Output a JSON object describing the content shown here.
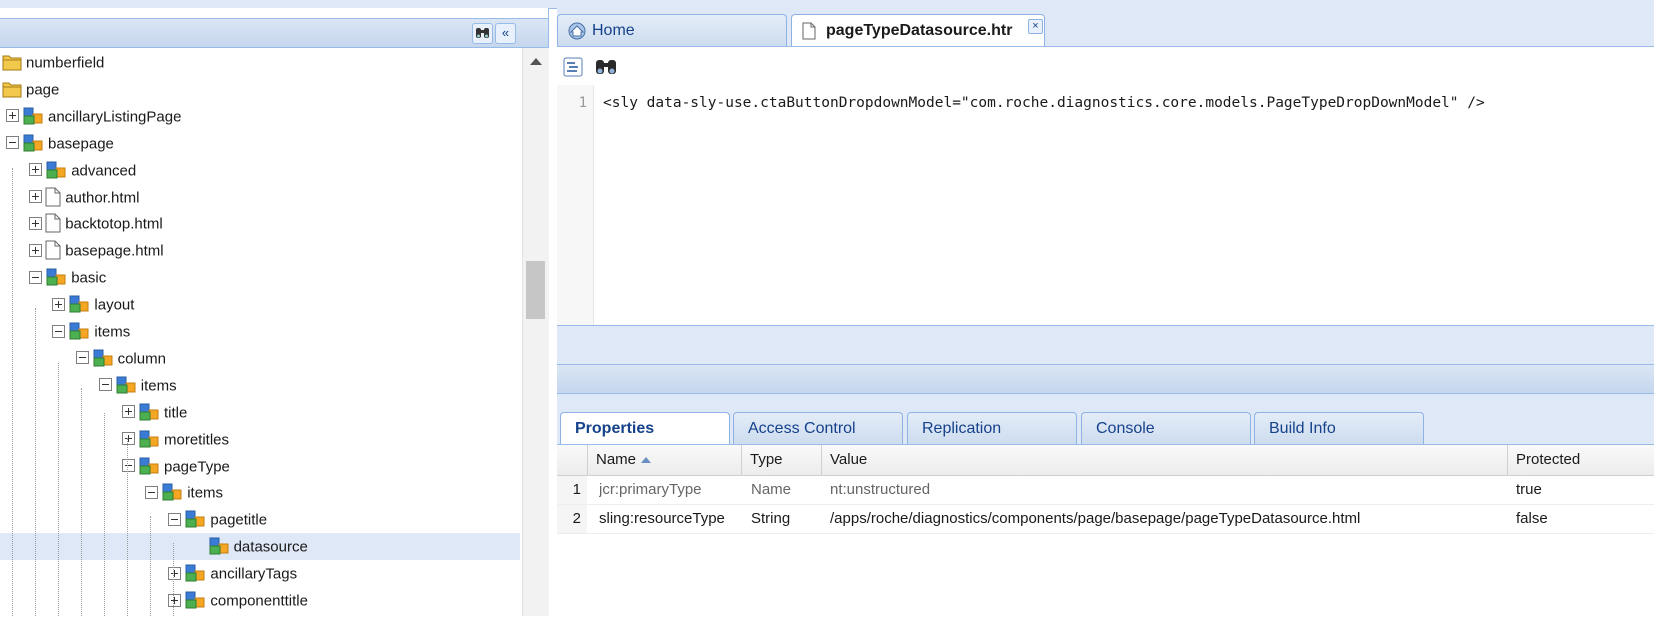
{
  "tree": {
    "header_buttons": [
      {
        "name": "find-button",
        "icon": "binoculars-icon"
      },
      {
        "name": "collapse-panel-button",
        "icon": "double-chevron-left-icon"
      }
    ],
    "nodes": [
      {
        "label": "numberfield",
        "type": "folder"
      },
      {
        "label": "page",
        "type": "folder"
      },
      {
        "label": "ancillaryListingPage",
        "type": "node",
        "toggle": "plus"
      },
      {
        "label": "basepage",
        "type": "node",
        "toggle": "minus"
      },
      {
        "label": "advanced",
        "type": "node",
        "toggle": "plus"
      },
      {
        "label": "author.html",
        "type": "file",
        "toggle": "plus"
      },
      {
        "label": "backtotop.html",
        "type": "file",
        "toggle": "plus"
      },
      {
        "label": "basepage.html",
        "type": "file",
        "toggle": "plus"
      },
      {
        "label": "basic",
        "type": "node",
        "toggle": "minus"
      },
      {
        "label": "layout",
        "type": "node",
        "toggle": "plus"
      },
      {
        "label": "items",
        "type": "node",
        "toggle": "minus"
      },
      {
        "label": "column",
        "type": "node",
        "toggle": "minus"
      },
      {
        "label": "items",
        "type": "node",
        "toggle": "minus"
      },
      {
        "label": "title",
        "type": "node",
        "toggle": "plus"
      },
      {
        "label": "moretitles",
        "type": "node",
        "toggle": "plus"
      },
      {
        "label": "pageType",
        "type": "node",
        "toggle": "minus"
      },
      {
        "label": "items",
        "type": "node",
        "toggle": "minus"
      },
      {
        "label": "pagetitle",
        "type": "node",
        "toggle": "minus"
      },
      {
        "label": "datasource",
        "type": "node",
        "toggle": "none",
        "selected": true
      },
      {
        "label": "ancillaryTags",
        "type": "node",
        "toggle": "plus"
      },
      {
        "label": "componenttitle",
        "type": "node",
        "toggle": "plus"
      }
    ]
  },
  "tabs": [
    {
      "label": "Home",
      "icon": "home-icon",
      "active": false
    },
    {
      "label": "pageTypeDatasource.htr",
      "icon": "file-icon",
      "active": true,
      "close": "×"
    }
  ],
  "editor": {
    "toolbar": [
      {
        "name": "format-button",
        "icon": "format-code-icon"
      },
      {
        "name": "search-button",
        "icon": "binoculars-icon"
      }
    ],
    "lines": [
      {
        "number": "1",
        "text": "<sly data-sly-use.ctaButtonDropdownModel=\"com.roche.diagnostics.core.models.PageTypeDropDownModel\" />"
      }
    ]
  },
  "properties": {
    "tabs": [
      "Properties",
      "Access Control",
      "Replication",
      "Console",
      "Build Info"
    ],
    "active_tab": "Properties",
    "columns": [
      "Name",
      "Type",
      "Value",
      "Protected"
    ],
    "sort_column": "Name",
    "sort_direction": "ascending",
    "rows": [
      {
        "num": "1",
        "name": "jcr:primaryType",
        "type": "Name",
        "value": "nt:unstructured",
        "protected": "true"
      },
      {
        "num": "2",
        "name": "sling:resourceType",
        "type": "String",
        "value": "/apps/roche/diagnostics/components/page/basepage/pageTypeDatasource.html",
        "protected": "false"
      }
    ]
  },
  "colors": {
    "panel_bg": "#dfe8f6",
    "border": "#99bbe8",
    "header_text": "#15428b",
    "selected_row": "#dfe8f6",
    "folder": "#f2c94c",
    "node_blue": "#3a7bd5",
    "node_green": "#4caf50",
    "node_orange": "#f5a623"
  }
}
